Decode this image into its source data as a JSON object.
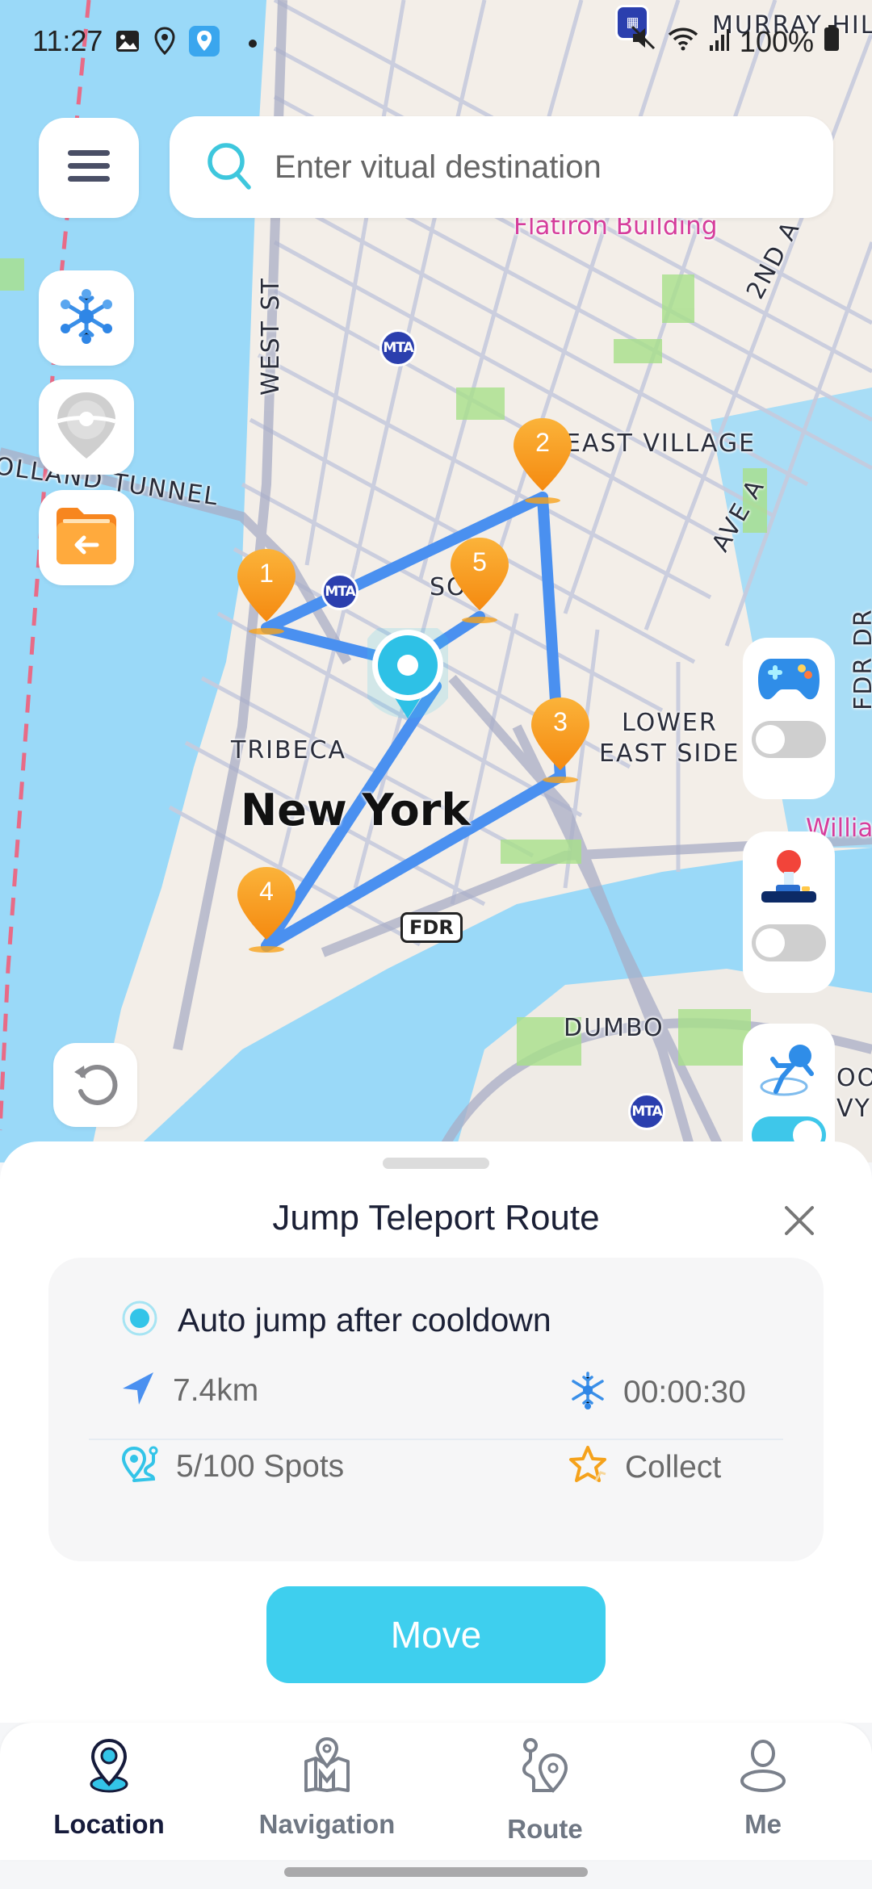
{
  "status_bar": {
    "time": "11:27",
    "left_icons": [
      "gallery-icon",
      "location-icon",
      "app-location-icon",
      "dot-icon"
    ],
    "right_icons": [
      "mute-icon",
      "wifi-icon",
      "signal-icon",
      "battery-icon"
    ],
    "battery": "100%"
  },
  "search": {
    "placeholder": "Enter vitual destination",
    "value": ""
  },
  "left_controls": [
    {
      "name": "freeze-icon"
    },
    {
      "name": "pokeball-pin-icon"
    },
    {
      "name": "import-folder-icon"
    }
  ],
  "right_controls": [
    {
      "name": "gamepad-icon",
      "toggle_on": false
    },
    {
      "name": "joystick-icon",
      "toggle_on": false
    },
    {
      "name": "teleport-runner-icon",
      "toggle_on": true
    }
  ],
  "map": {
    "labels": {
      "flatiron": "Flatiron Building",
      "second_ave": "2ND A",
      "west_st": "WEST ST",
      "holland_tunnel": "OLLAND TUNNEL",
      "east_village": "EAST VILLAGE",
      "ave_a": "AVE A",
      "soho": "SO",
      "tribeca": "TRIBECA",
      "lower_east_side_1": "LOWER",
      "lower_east_side_2": "EAST SIDE",
      "new_york": "New York",
      "fdr_shield": "FDR",
      "fdr_dr": "FDR DR",
      "dumbo": "DUMBO",
      "williamsburg": "Williams",
      "murray_hill": "MURRAY HIL",
      "brooklyn_1": "OOK",
      "brooklyn_2": "VY Y",
      "mta": "MTA"
    },
    "route_pins": [
      "1",
      "2",
      "3",
      "4",
      "5"
    ],
    "route_color": "#4a90f0",
    "pin_color": "#f7a21b",
    "current_location_color": "#2ec1e6"
  },
  "sheet": {
    "title": "Jump Teleport Route",
    "option_label": "Auto jump after cooldown",
    "option_selected": true,
    "distance": "7.4km",
    "cooldown": "00:00:30",
    "spots": "5/100 Spots",
    "collect_label": "Collect",
    "move_label": "Move"
  },
  "nav": {
    "items": [
      {
        "label": "Location",
        "active": true
      },
      {
        "label": "Navigation",
        "active": false
      },
      {
        "label": "Route",
        "active": false
      },
      {
        "label": "Me",
        "active": false
      }
    ]
  },
  "colors": {
    "accent": "#3ecfee",
    "title_text": "#1b2036",
    "secondary_text": "#6a6a6a"
  }
}
